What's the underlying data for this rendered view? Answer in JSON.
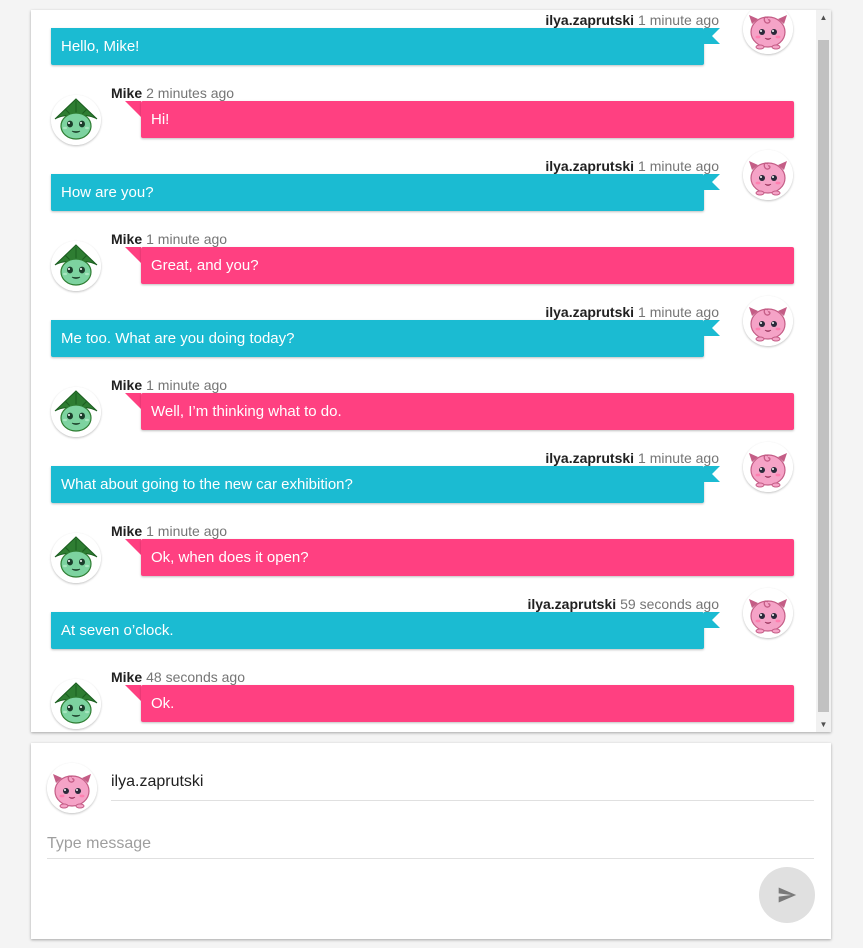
{
  "messages": [
    {
      "author": "ilya.zaprutski",
      "time": "1 minute ago",
      "text": "Hello, Mike!",
      "mine": true
    },
    {
      "author": "Mike",
      "time": "2 minutes ago",
      "text": "Hi!",
      "mine": false
    },
    {
      "author": "ilya.zaprutski",
      "time": "1 minute ago",
      "text": "How are you?",
      "mine": true
    },
    {
      "author": "Mike",
      "time": "1 minute ago",
      "text": "Great, and you?",
      "mine": false
    },
    {
      "author": "ilya.zaprutski",
      "time": "1 minute ago",
      "text": "Me too. What are you doing today?",
      "mine": true
    },
    {
      "author": "Mike",
      "time": "1 minute ago",
      "text": "Well, I’m thinking what to do.",
      "mine": false
    },
    {
      "author": "ilya.zaprutski",
      "time": "1 minute ago",
      "text": "What about going to the new car exhibition?",
      "mine": true
    },
    {
      "author": "Mike",
      "time": "1 minute ago",
      "text": "Ok, when does it open?",
      "mine": false
    },
    {
      "author": "ilya.zaprutski",
      "time": "59 seconds ago",
      "text": "At seven o’clock.",
      "mine": true
    },
    {
      "author": "Mike",
      "time": "48 seconds ago",
      "text": "Ok.",
      "mine": false
    }
  ],
  "compose": {
    "username": "ilya.zaprutski",
    "placeholder": "Type message",
    "send_icon": "send-icon"
  },
  "colors": {
    "mine_bubble": "#1bbbd2",
    "their_bubble": "#ff4081",
    "send_button": "#e0e0e0"
  },
  "avatars": {
    "mine": "pink-creature-avatar",
    "theirs": "green-creature-avatar"
  }
}
